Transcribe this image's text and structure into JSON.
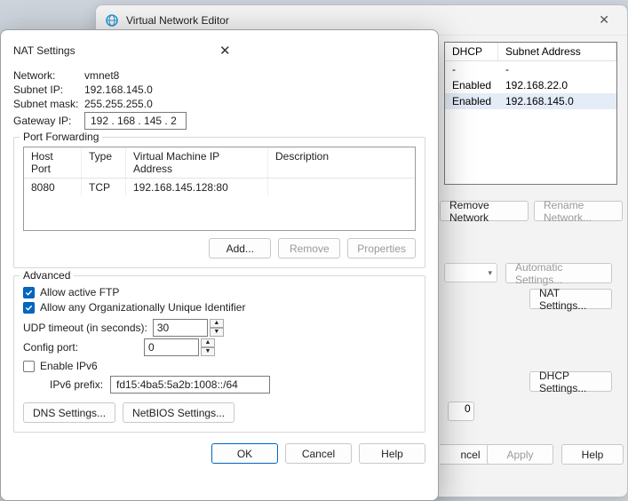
{
  "parent": {
    "title": "Virtual Network Editor",
    "cols": {
      "dhcp": "DHCP",
      "subnet": "Subnet Address"
    },
    "rows": [
      {
        "dhcp": "-",
        "subnet": "-"
      },
      {
        "dhcp": "Enabled",
        "subnet": "192.168.22.0"
      },
      {
        "dhcp": "Enabled",
        "subnet": "192.168.145.0"
      }
    ],
    "remove_btn": "Remove Network",
    "rename_btn": "Rename Network...",
    "auto_btn": "Automatic Settings...",
    "nat_btn": "NAT Settings...",
    "dhcp_btn": "DHCP Settings...",
    "partial_btn": "0",
    "cancel_tail": "ncel",
    "apply": "Apply",
    "help": "Help"
  },
  "dialog": {
    "title": "NAT Settings",
    "network_lbl": "Network:",
    "network_val": "vmnet8",
    "subnetip_lbl": "Subnet IP:",
    "subnetip_val": "192.168.145.0",
    "mask_lbl": "Subnet mask:",
    "mask_val": "255.255.255.0",
    "gateway_lbl": "Gateway IP:",
    "gateway_val": "192 . 168 . 145 .  2",
    "pf_group": "Port Forwarding",
    "pf_cols": {
      "host": "Host Port",
      "type": "Type",
      "vm": "Virtual Machine IP Address",
      "desc": "Description"
    },
    "pf_row": {
      "host": "8080",
      "type": "TCP",
      "vm": "192.168.145.128:80",
      "desc": ""
    },
    "pf_add": "Add...",
    "pf_remove": "Remove",
    "pf_props": "Properties",
    "adv_group": "Advanced",
    "allow_ftp": "Allow active FTP",
    "allow_oui": "Allow any Organizationally Unique Identifier",
    "udp_lbl": "UDP timeout (in seconds):",
    "udp_val": "30",
    "cfg_lbl": "Config port:",
    "cfg_val": "0",
    "ipv6_lbl": "Enable IPv6",
    "ipv6_prefix_lbl": "IPv6 prefix:",
    "ipv6_prefix_val": "fd15:4ba5:5a2b:1008::/64",
    "dns_btn": "DNS Settings...",
    "netbios_btn": "NetBIOS Settings...",
    "ok": "OK",
    "cancel": "Cancel",
    "help": "Help"
  }
}
